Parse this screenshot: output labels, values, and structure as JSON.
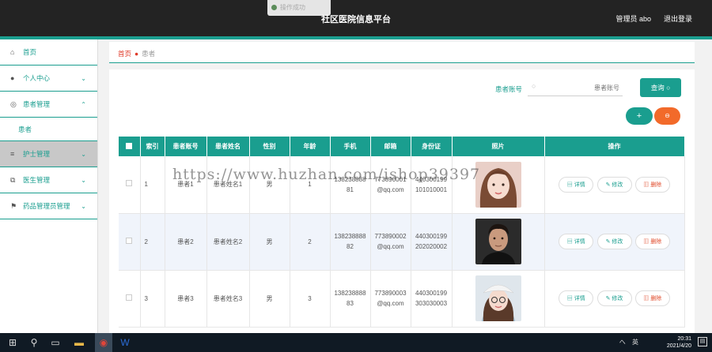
{
  "app": {
    "title": "社区医院信息平台",
    "admin_label": "管理员 abo",
    "logout_label": "退出登录",
    "toast": "操作成功"
  },
  "sidebar": {
    "items": [
      {
        "label": "首页",
        "icon": "home-icon"
      },
      {
        "label": "个人中心",
        "icon": "user-icon"
      },
      {
        "label": "患者管理",
        "icon": "globe-icon"
      },
      {
        "label": "患者",
        "icon": ""
      },
      {
        "label": "护士管理",
        "icon": "list-icon"
      },
      {
        "label": "医生管理",
        "icon": "copy-icon"
      },
      {
        "label": "药品管理员管理",
        "icon": "flag-icon"
      }
    ]
  },
  "breadcrumb": {
    "home": "首页",
    "current": "患者"
  },
  "search": {
    "label": "患者账号",
    "placeholder": "患者账号",
    "button": "查询"
  },
  "actions": {
    "add": "+",
    "delete": "⊖"
  },
  "table": {
    "headers": [
      "索引",
      "患者账号",
      "患者姓名",
      "性别",
      "年龄",
      "手机",
      "邮箱",
      "身份证",
      "照片",
      "操作"
    ],
    "rows": [
      {
        "index": "1",
        "account": "患者1",
        "name": "患者姓名1",
        "gender": "男",
        "age": "1",
        "phone": "13823888881",
        "email": "773890001@qq.com",
        "idcard": "440300199101010001"
      },
      {
        "index": "2",
        "account": "患者2",
        "name": "患者姓名2",
        "gender": "男",
        "age": "2",
        "phone": "13823888882",
        "email": "773890002@qq.com",
        "idcard": "440300199202020002"
      },
      {
        "index": "3",
        "account": "患者3",
        "name": "患者姓名3",
        "gender": "男",
        "age": "3",
        "phone": "13823888883",
        "email": "773890003@qq.com",
        "idcard": "440300199303030003"
      }
    ],
    "ops": {
      "detail": "详情",
      "edit": "修改",
      "remove": "删除"
    }
  },
  "watermark": "https://www.huzhan.com/ishop39397",
  "taskbar": {
    "tray": "へ 英",
    "time": "20:31",
    "date": "2021/4/20"
  },
  "colors": {
    "accent": "#1a9e8f",
    "danger": "#f26a2a",
    "topbar": "#232323"
  }
}
